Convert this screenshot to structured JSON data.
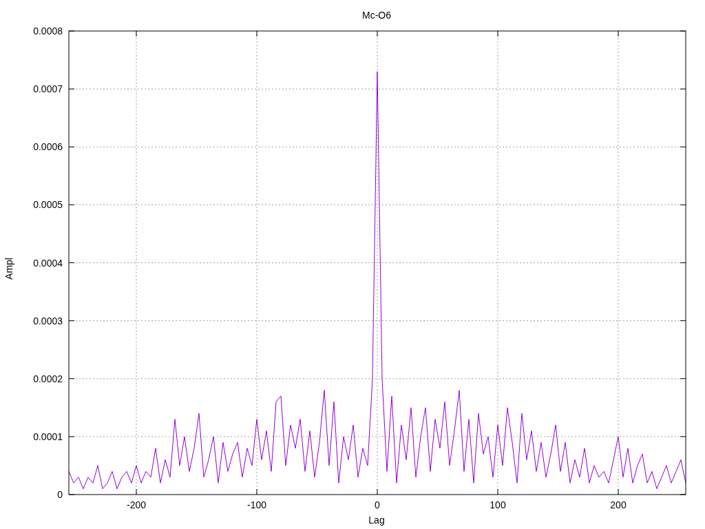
{
  "chart_data": {
    "type": "line",
    "grid": true,
    "title": "Mc-O6",
    "xlabel": "Lag",
    "ylabel": "Ampl",
    "xlim": [
      -256,
      256
    ],
    "ylim": [
      0,
      0.0008
    ],
    "xticks": [
      -200,
      -100,
      0,
      100,
      200
    ],
    "yticks": [
      {
        "value": 0,
        "label": "0"
      },
      {
        "value": 0.0001,
        "label": "0.0001"
      },
      {
        "value": 0.0002,
        "label": "0.0002"
      },
      {
        "value": 0.0003,
        "label": "0.0003"
      },
      {
        "value": 0.0004,
        "label": "0.0004"
      },
      {
        "value": 0.0005,
        "label": "0.0005"
      },
      {
        "value": 0.0006,
        "label": "0.0006"
      },
      {
        "value": 0.0007,
        "label": "0.0007"
      },
      {
        "value": 0.0008,
        "label": "0.0008"
      }
    ],
    "x": [
      -256,
      -252,
      -248,
      -244,
      -240,
      -236,
      -232,
      -228,
      -224,
      -220,
      -216,
      -212,
      -208,
      -204,
      -200,
      -196,
      -192,
      -188,
      -184,
      -180,
      -176,
      -172,
      -168,
      -164,
      -160,
      -156,
      -152,
      -148,
      -144,
      -140,
      -136,
      -132,
      -128,
      -124,
      -120,
      -116,
      -112,
      -108,
      -104,
      -100,
      -96,
      -92,
      -88,
      -84,
      -80,
      -76,
      -72,
      -68,
      -64,
      -60,
      -56,
      -52,
      -48,
      -44,
      -40,
      -36,
      -32,
      -28,
      -24,
      -20,
      -16,
      -12,
      -8,
      -4,
      0,
      4,
      8,
      12,
      16,
      20,
      24,
      28,
      32,
      36,
      40,
      44,
      48,
      52,
      56,
      60,
      64,
      68,
      72,
      76,
      80,
      84,
      88,
      92,
      96,
      100,
      104,
      108,
      112,
      116,
      120,
      124,
      128,
      132,
      136,
      140,
      144,
      148,
      152,
      156,
      160,
      164,
      168,
      172,
      176,
      180,
      184,
      188,
      192,
      196,
      200,
      204,
      208,
      212,
      216,
      220,
      224,
      228,
      232,
      236,
      240,
      244,
      248,
      252,
      256
    ],
    "series": [
      {
        "color": "#9400d3",
        "values": [
          4e-05,
          2e-05,
          3e-05,
          1e-05,
          3e-05,
          2e-05,
          5e-05,
          1e-05,
          2e-05,
          4e-05,
          1e-05,
          3e-05,
          4e-05,
          2e-05,
          5e-05,
          2e-05,
          4e-05,
          3e-05,
          8e-05,
          2e-05,
          6e-05,
          3e-05,
          0.00013,
          5e-05,
          0.0001,
          4e-05,
          8e-05,
          0.00014,
          3e-05,
          6e-05,
          0.0001,
          2e-05,
          9e-05,
          4e-05,
          7e-05,
          9e-05,
          3e-05,
          8e-05,
          5e-05,
          0.00013,
          6e-05,
          0.00011,
          4e-05,
          0.00016,
          0.00017,
          5e-05,
          0.00012,
          8e-05,
          0.00013,
          4e-05,
          0.00011,
          3e-05,
          9e-05,
          0.00018,
          5e-05,
          0.00016,
          2e-05,
          0.0001,
          6e-05,
          0.00012,
          3e-05,
          8e-05,
          5e-05,
          0.0002,
          0.00073,
          0.0002,
          4e-05,
          0.00017,
          2e-05,
          0.00012,
          6e-05,
          0.00015,
          3e-05,
          0.0001,
          0.00015,
          4e-05,
          0.00013,
          8e-05,
          0.00016,
          5e-05,
          0.00011,
          0.00018,
          4e-05,
          0.00013,
          2e-05,
          0.00014,
          7e-05,
          0.0001,
          3e-05,
          0.00012,
          5e-05,
          0.00015,
          9e-05,
          2e-05,
          0.00014,
          6e-05,
          0.00011,
          4e-05,
          9e-05,
          3e-05,
          7e-05,
          0.00012,
          4e-05,
          9e-05,
          2e-05,
          6e-05,
          3e-05,
          8e-05,
          2e-05,
          5e-05,
          3e-05,
          4e-05,
          2e-05,
          6e-05,
          0.0001,
          3e-05,
          8e-05,
          2e-05,
          5e-05,
          7e-05,
          2e-05,
          4e-05,
          1e-05,
          3e-05,
          5e-05,
          2e-05,
          4e-05,
          6e-05,
          2e-05
        ]
      }
    ]
  }
}
